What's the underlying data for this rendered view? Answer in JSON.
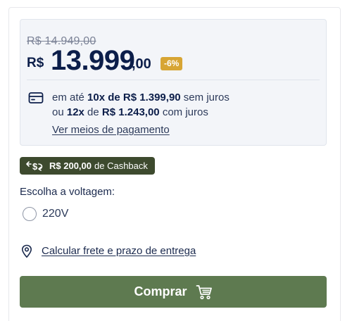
{
  "pricing": {
    "old_price": "R$ 14.949,00",
    "currency": "R$",
    "price_integer": "13.999",
    "price_cents": ",00",
    "discount_badge": "-6%",
    "installments": {
      "prefix_1": "em até ",
      "count_1": "10x de R$ 1.399,90",
      "suffix_1": " sem juros",
      "prefix_2": "ou ",
      "count_2": "12x",
      "mid_2": " de ",
      "amount_2": "R$ 1.243,00",
      "suffix_2": " com juros"
    },
    "payment_link": "Ver meios de pagamento",
    "icons": {
      "card": "credit-card-icon"
    }
  },
  "cashback": {
    "icon": "cashback-icon",
    "amount": "R$ 200,00",
    "label": " de Cashback"
  },
  "voltage": {
    "label": "Escolha a voltagem:",
    "options": [
      {
        "label": "220V",
        "selected": false
      }
    ]
  },
  "shipping": {
    "icon": "location-pin-icon",
    "link": "Calcular frete e prazo de entrega"
  },
  "buy_button": {
    "label": "Comprar",
    "icon": "shopping-cart-icon"
  },
  "colors": {
    "price": "#0c1e4a",
    "badge": "#d7a534",
    "cashback_bg": "#3d4a2e",
    "button_bg": "#5e7a50"
  }
}
